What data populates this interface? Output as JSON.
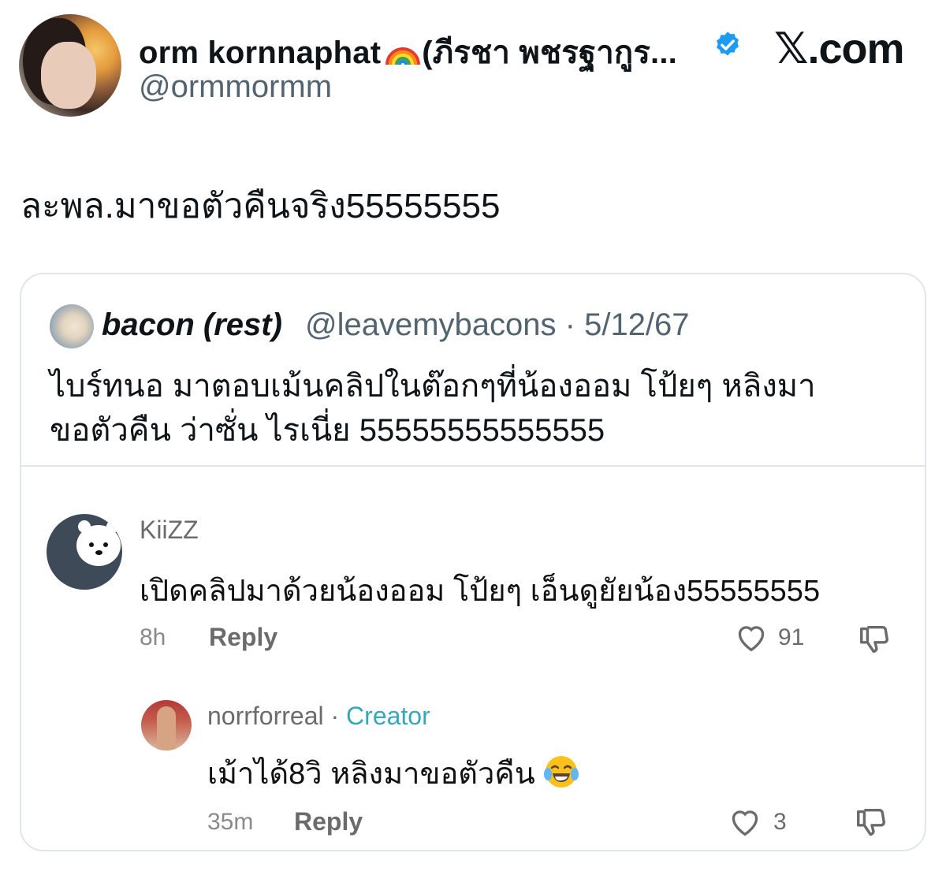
{
  "author": {
    "display_name": "orm kornnaphat",
    "display_name_suffix": "(ภีรชา พชรฐากูร...",
    "handle": "@ormmormm",
    "verified": true
  },
  "brand": "𝕏.com",
  "tweet": {
    "text": "ละพล.มาขอตัวคืนจริง55555555"
  },
  "quote": {
    "name": "bacon (rest)",
    "handle_date": "@leavemybacons · 5/12/67",
    "text": "ไบร์ทนอ มาตอบเม้นคลิปในต๊อกๆที่น้องออม โป้ยๆ หลิงมา ขอตัวคืน ว่าซั่น ไรเนี่ย 55555555555555"
  },
  "comments": [
    {
      "user": "KiiZZ",
      "text": "เปิดคลิปมาด้วยน้องออม โป้ยๆ เอ็นดูยัยน้อง55555555",
      "time": "8h",
      "reply": "Reply",
      "likes": "91"
    },
    {
      "user": "norrforreal",
      "separator": " · ",
      "badge": "Creator",
      "text": "เม้าได้8วิ หลิงมาขอตัวคืน",
      "time": "35m",
      "reply": "Reply",
      "likes": "3"
    }
  ],
  "colors": {
    "verified": "#1d9bf0",
    "creator": "#3aa6b9",
    "muted": "#536471"
  },
  "icons": {
    "rainbow": "rainbow-emoji",
    "verified": "verified-badge-icon",
    "like": "heart-icon",
    "dislike": "thumbs-down-icon",
    "laugh": "tears-of-joy-emoji"
  }
}
